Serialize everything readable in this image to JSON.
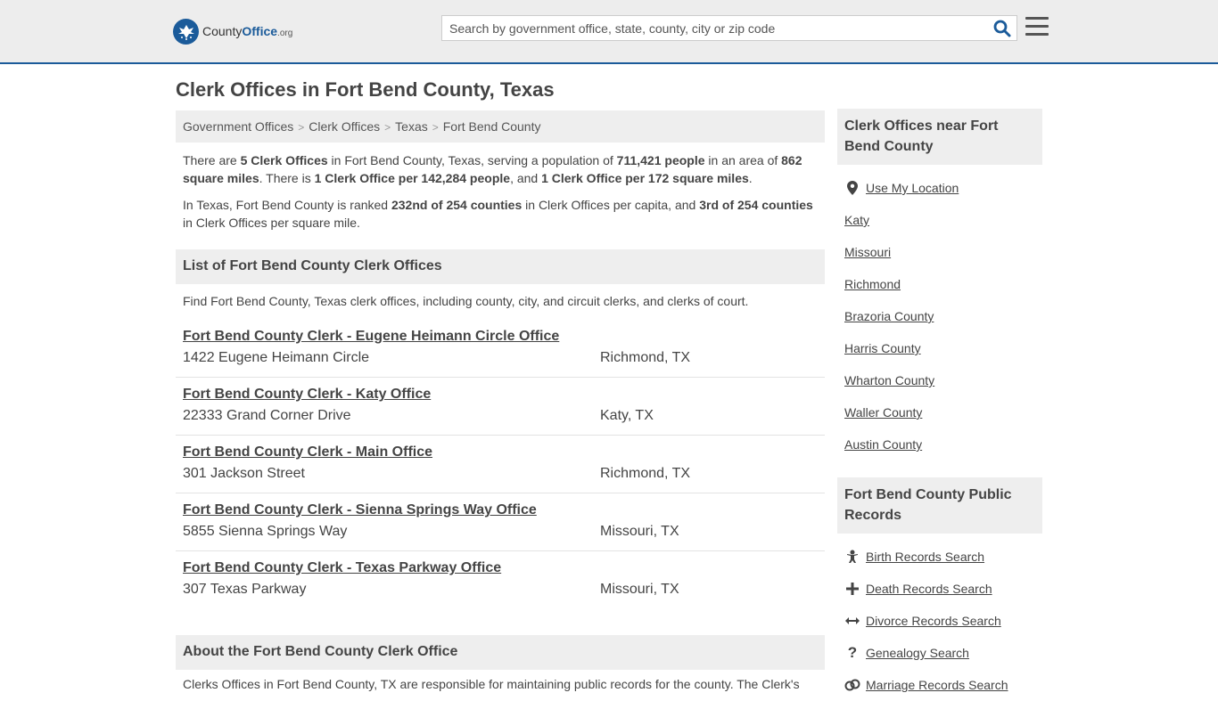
{
  "header": {
    "logo": {
      "part1": "County",
      "part2": "Office",
      "tld": ".org"
    },
    "search_placeholder": "Search by government office, state, county, city or zip code"
  },
  "page_title": "Clerk Offices in Fort Bend County, Texas",
  "breadcrumb": [
    "Government Offices",
    "Clerk Offices",
    "Texas",
    "Fort Bend County"
  ],
  "summary": {
    "p1": [
      {
        "t": "There are ",
        "b": false
      },
      {
        "t": "5 Clerk Offices",
        "b": true
      },
      {
        "t": " in Fort Bend County, Texas, serving a population of ",
        "b": false
      },
      {
        "t": "711,421 people",
        "b": true
      },
      {
        "t": " in an area of ",
        "b": false
      },
      {
        "t": "862 square miles",
        "b": true
      },
      {
        "t": ". There is ",
        "b": false
      },
      {
        "t": "1 Clerk Office per 142,284 people",
        "b": true
      },
      {
        "t": ", and ",
        "b": false
      },
      {
        "t": "1 Clerk Office per 172 square miles",
        "b": true
      },
      {
        "t": ".",
        "b": false
      }
    ],
    "p2": [
      {
        "t": "In Texas, Fort Bend County is ranked ",
        "b": false
      },
      {
        "t": "232nd of 254 counties",
        "b": true
      },
      {
        "t": " in Clerk Offices per capita, and ",
        "b": false
      },
      {
        "t": "3rd of 254 counties",
        "b": true
      },
      {
        "t": " in Clerk Offices per square mile.",
        "b": false
      }
    ]
  },
  "list_section": {
    "heading": "List of Fort Bend County Clerk Offices",
    "intro": "Find Fort Bend County, Texas clerk offices, including county, city, and circuit clerks, and clerks of court.",
    "offices": [
      {
        "name": "Fort Bend County Clerk - Eugene Heimann Circle Office",
        "address": "1422 Eugene Heimann Circle",
        "city": "Richmond, TX"
      },
      {
        "name": "Fort Bend County Clerk - Katy Office",
        "address": "22333 Grand Corner Drive",
        "city": "Katy, TX"
      },
      {
        "name": "Fort Bend County Clerk - Main Office",
        "address": "301 Jackson Street",
        "city": "Richmond, TX"
      },
      {
        "name": "Fort Bend County Clerk - Sienna Springs Way Office",
        "address": "5855 Sienna Springs Way",
        "city": "Missouri, TX"
      },
      {
        "name": "Fort Bend County Clerk - Texas Parkway Office",
        "address": "307 Texas Parkway",
        "city": "Missouri, TX"
      }
    ]
  },
  "about": {
    "heading": "About the Fort Bend County Clerk Office",
    "text": "Clerks Offices in Fort Bend County, TX are responsible for maintaining public records for the county. The Clerk's"
  },
  "sidebar": {
    "nearby_heading": "Clerk Offices near Fort Bend County",
    "use_location": "Use My Location",
    "nearby": [
      "Katy",
      "Missouri",
      "Richmond",
      "Brazoria County",
      "Harris County",
      "Wharton County",
      "Waller County",
      "Austin County"
    ],
    "records_heading": "Fort Bend County Public Records",
    "records": [
      {
        "label": "Birth Records Search",
        "icon": "baby-icon"
      },
      {
        "label": "Death Records Search",
        "icon": "cross-icon"
      },
      {
        "label": "Divorce Records Search",
        "icon": "split-arrows-icon"
      },
      {
        "label": "Genealogy Search",
        "icon": "question-icon"
      },
      {
        "label": "Marriage Records Search",
        "icon": "rings-icon"
      }
    ]
  },
  "colors": {
    "brand": "#1b5b9a",
    "header_bg": "#ededed",
    "panel_bg": "#eeeeee",
    "text": "#444444"
  }
}
